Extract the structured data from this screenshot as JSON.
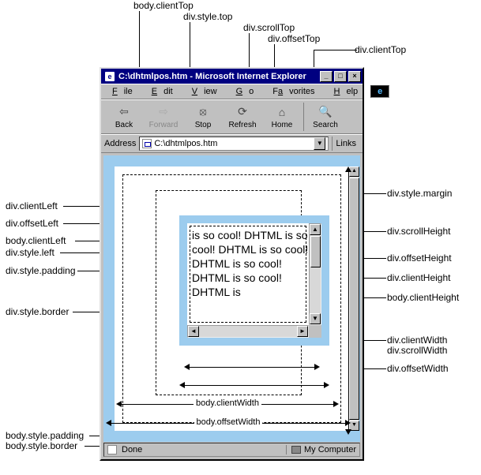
{
  "window": {
    "title": "C:\\dhtmlpos.htm - Microsoft Internet Explorer"
  },
  "menus": [
    "ile",
    "dit",
    "iew",
    "o",
    "vorites",
    "elp"
  ],
  "toolbar": [
    "Back",
    "Forward",
    "Stop",
    "Refresh",
    "Home",
    "Search"
  ],
  "address": {
    "label": "Address",
    "url": "C:\\dhtmlpos.htm",
    "links": "Links"
  },
  "content": {
    "text": "is so cool! DHTML is so cool! DHTML is so cool! DHTML is so cool! DHTML is so cool! DHTML is"
  },
  "status": {
    "text": "Done",
    "zone": "My Computer"
  },
  "dims": {
    "bodyClientWidth": "body.clientWidth",
    "bodyOffsetWidth": "body.offsetWidth"
  },
  "callouts": {
    "top": [
      "body.clientTop",
      "div.style.top",
      "div.scrollTop",
      "div.offsetTop",
      "div.clientTop"
    ],
    "left": [
      "div.clientLeft",
      "div.offsetLeft",
      "body.clientLeft",
      "div.style.left",
      "div.style.padding",
      "div.style.border"
    ],
    "right": [
      "div.style.margin",
      "div.scrollHeight",
      "div.offsetHeight",
      "div.clientHeight",
      "body.clientHeight",
      "div.clientWidth",
      "div.scrollWidth",
      "div.offsetWidth"
    ],
    "bottomleft": [
      "body.style.padding",
      "body.style.border"
    ]
  },
  "colors": {
    "borderBlue": "#9cccee",
    "winGray": "#c0c0c0",
    "titleBlue": "#000080"
  }
}
